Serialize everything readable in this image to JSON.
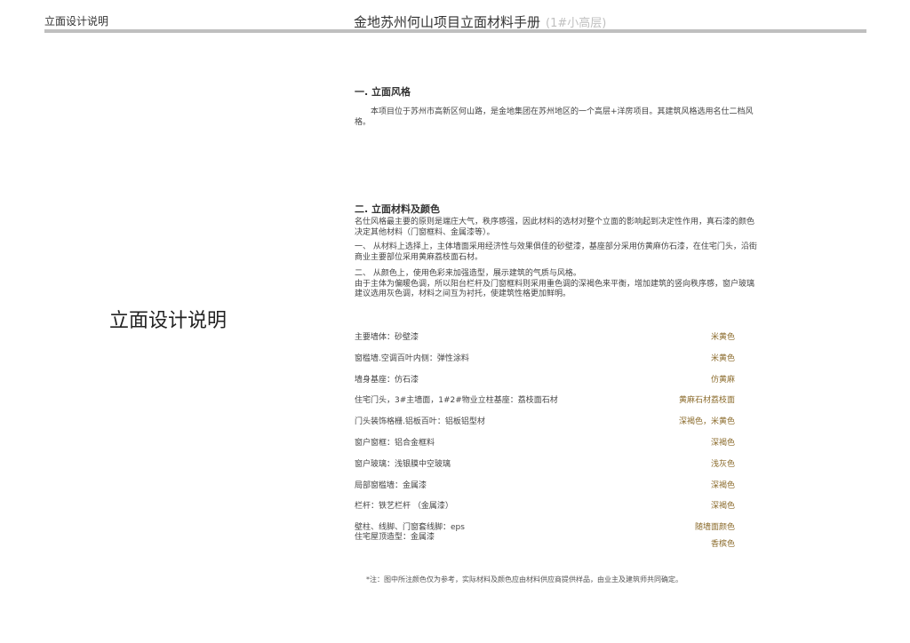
{
  "header": {
    "left_label": "立面设计说明",
    "title": "金地苏州何山项目立面材料手册",
    "subtitle": "(1#小高层)"
  },
  "side_title": "立面设计说明",
  "section1": {
    "heading": "一. 立面风格",
    "body": "本项目位于苏州市高新区何山路，是金地集团在苏州地区的一个高层+洋房项目。其建筑风格选用名仕二档风格。"
  },
  "section2": {
    "heading": "二. 立面材料及颜色",
    "paragraphs": [
      "名仕风格最主要的原则是端庄大气，秩序感强，因此材料的选材对整个立面的影响起到决定性作用，真石漆的颜色决定其他材料（门窗框料、金属漆等）。",
      "一、    从材料上选择上，主体墙面采用经济性与效果俱佳的砂壁漆，基座部分采用仿黄麻仿石漆，在住宅门头，沿街商业主要部位采用黄麻荔枝面石材。",
      "二、    从颜色上，使用色彩来加强造型，展示建筑的气质与风格。\n由于主体为偏暖色调，所以阳台栏杆及门窗框料则采用重色调的深褐色来平衡，增加建筑的竖向秩序感，窗户玻璃建议选用灰色调，材料之间互为衬托，使建筑性格更加鲜明。"
    ]
  },
  "materials": [
    {
      "name": "主要墙体：砂壁漆",
      "color": "米黄色"
    },
    {
      "name": "窗槛墙.空调百叶内侧：弹性涂料",
      "color": "米黄色"
    },
    {
      "name": "墙身基座：仿石漆",
      "color": "仿黄麻"
    },
    {
      "name": "住宅门头，3#主墙面，1#2#物业立柱基座：荔枝面石材",
      "color": "黄麻石材荔枝面"
    },
    {
      "name": "门头装饰格栅.铝板百叶：铝板铝型材",
      "color": "深褐色，米黄色"
    },
    {
      "name": "窗户窗框：铝合金框料",
      "color": "深褐色"
    },
    {
      "name": "窗户玻璃：浅银膜中空玻璃",
      "color": "浅灰色"
    },
    {
      "name": "局部窗槛墙：金属漆",
      "color": "深褐色"
    },
    {
      "name": "栏杆：铁艺栏杆 （金属漆）",
      "color": "深褐色"
    }
  ],
  "materials_last": {
    "name1": "壁柱、线脚、门窗套线脚：eps",
    "color1": "随墙面颜色",
    "name2": "住宅屋顶造型：金属漆",
    "color2": "香槟色"
  },
  "footnote": "*注：图中所注颜色仅为参考，实际材料及颜色应由材料供应商提供样品，由业主及建筑师共同确定。"
}
